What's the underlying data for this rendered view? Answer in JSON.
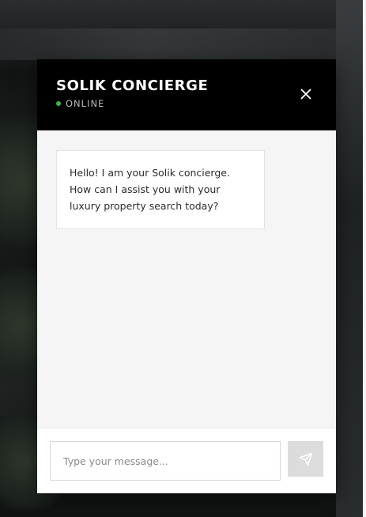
{
  "chat": {
    "title": "SOLIK CONCIERGE",
    "status": "ONLINE",
    "status_color": "#3bb54a",
    "close_icon": "close-icon",
    "messages": [
      {
        "sender": "concierge",
        "text": "Hello! I am your Solik concierge. How can I assist you with your luxury property search today?"
      }
    ],
    "input": {
      "placeholder": "Type your message...",
      "value": ""
    },
    "send_icon": "send-icon"
  },
  "colors": {
    "header_bg": "#000000",
    "messages_bg": "#f5f5f5",
    "send_button_bg": "#dcdcdc"
  }
}
